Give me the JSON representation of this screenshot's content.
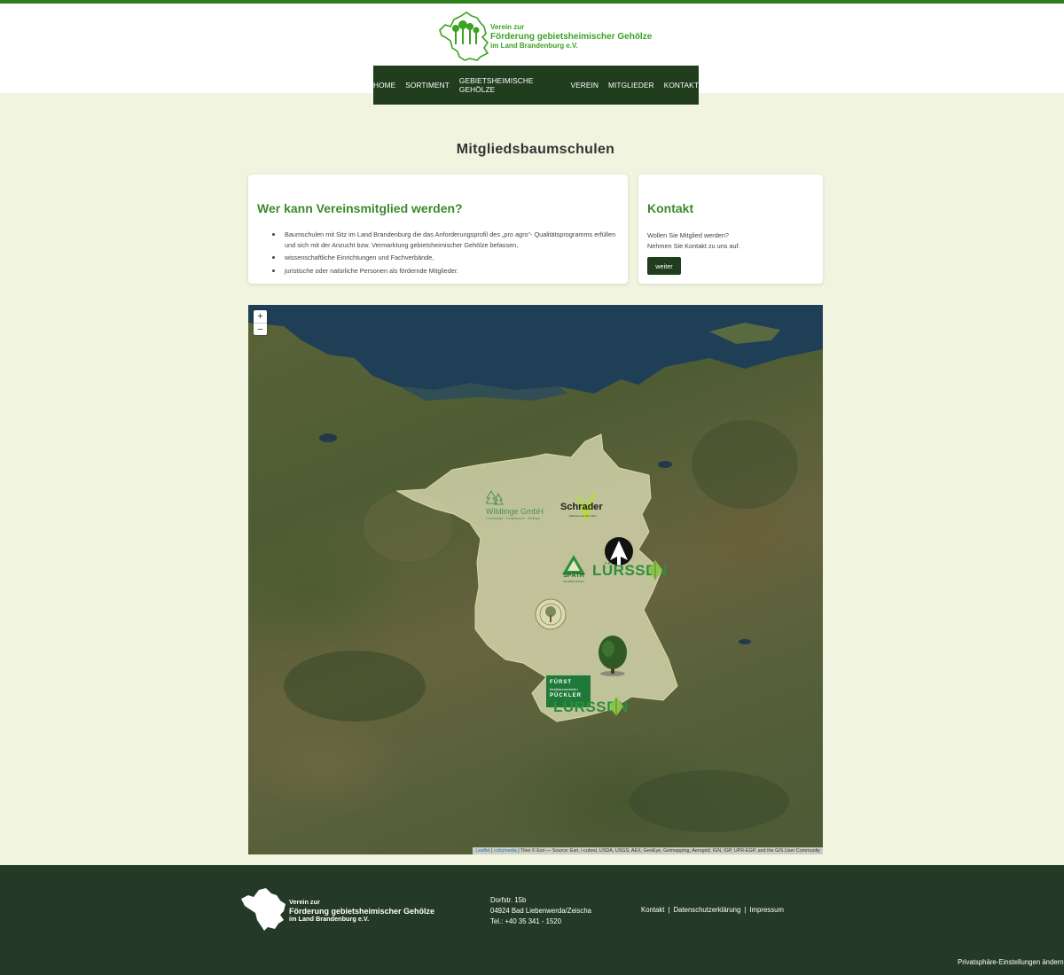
{
  "colors": {
    "brand_green": "#3aa321",
    "nav_dark": "#203d1e",
    "footer_dark": "#243a26",
    "page_bg": "#f1f4df"
  },
  "logo": {
    "line1": "Verein zur",
    "line2": "Förderung gebietsheimischer Gehölze",
    "line3": "im Land Brandenburg e.V."
  },
  "nav": {
    "items": [
      "HOME",
      "SORTIMENT",
      "GEBIETSHEIMISCHE GEHÖLZE",
      "VEREIN",
      "MITGLIEDER",
      "KONTAKT"
    ]
  },
  "page": {
    "title": "Mitgliedsbaumschulen"
  },
  "membership": {
    "heading": "Wer kann Vereinsmitglied werden?",
    "items": [
      "Baumschulen mit Sitz im Land Brandenburg die das Anforderungsprofil des „pro agro“- Qualitätsprogramms erfüllen und sich mit der Anzucht bzw. Vermarktung gebietsheimischer Gehölze befassen,",
      "wissenschaftliche Einrichtungen und Fachverbände,",
      "juristische oder natürliche Personen als fördernde Mitglieder."
    ]
  },
  "contact_card": {
    "heading": "Kontakt",
    "line1": "Wollen Sie Mitglied werden?",
    "line2": "Nehmen Sie Kontakt zu uns auf.",
    "button": "weiter"
  },
  "map": {
    "zoom_in": "+",
    "zoom_out": "−",
    "attribution_leaflet": "Leaflet",
    "attribution_osm": "ccbymedia",
    "attribution_rest": "| Tiles © Esri — Source: Esri, i-cubed, USDA, USGS, AEX, GeoEye, Getmapping, Aerogrid, IGN, IGP, UPR-EGP, and the GIS User Community",
    "markers": {
      "wildlinge": {
        "name": "Wildlinge GmbH",
        "sub": "Forstsaatgut · Forstpflanzen · Wildlinge"
      },
      "schrader": {
        "name": "Schrader",
        "sub": "Pflanzen aus der Natur"
      },
      "spaeth": {
        "name": "SPÄTH",
        "sub": "BAUMSCHULEN"
      },
      "luerssen1": {
        "name": "LÜRSSEN"
      },
      "fuerst": {
        "line1": "FÜRST",
        "line2": "forstbaumschulen",
        "line3": "PÜCKLER"
      },
      "luerssen2": {
        "name": "LÜRSSEN"
      }
    }
  },
  "footer": {
    "logo": {
      "line1": "Verein zur",
      "line2": "Förderung gebietsheimischer Gehölze",
      "line3": "im Land Brandenburg e.V."
    },
    "address": {
      "street": "Dorfstr. 15b",
      "city": "04924 Bad Liebenwerda/Zeischa",
      "phone": "Tel.: +40 35 341 - 1520"
    },
    "links": [
      "Kontakt",
      "Datenschutzerklärung",
      "Impressum"
    ],
    "privacy": "Privatsphäre-Einstellungen ändern"
  }
}
